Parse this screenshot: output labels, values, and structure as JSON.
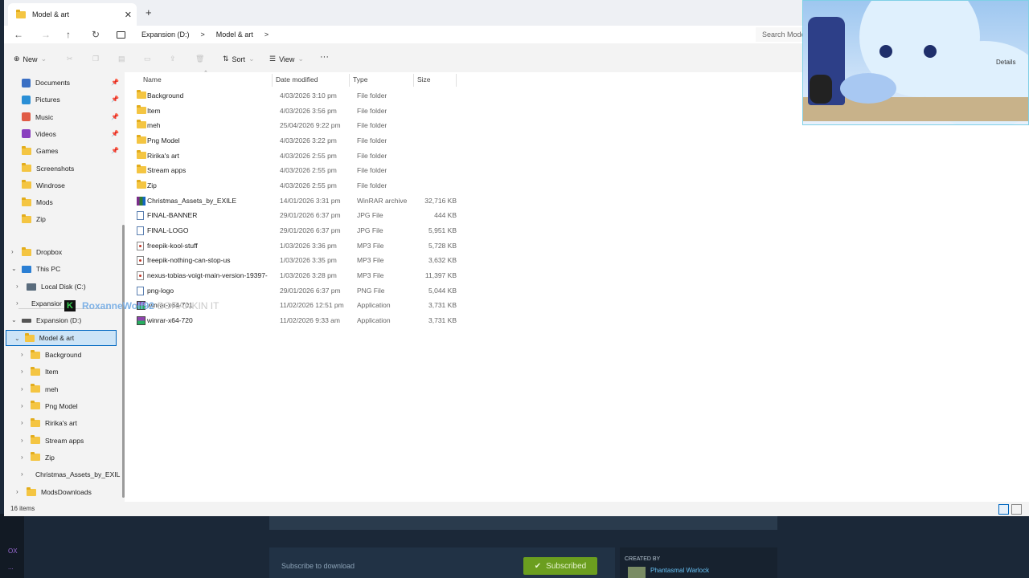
{
  "window": {
    "tab_title": "Model & art",
    "tab_close": "✕",
    "new_tab": "+",
    "controls": [
      "—",
      "▢",
      "✕"
    ]
  },
  "nav": {
    "back": "←",
    "forward": "→",
    "up": "↑",
    "refresh": "↻",
    "breadcrumb": [
      "Expansion (D:)",
      ">",
      "Model & art",
      ">"
    ],
    "search_placeholder": "Search Model & art"
  },
  "toolbar": {
    "new_label": "New",
    "sort_label": "Sort",
    "view_label": "View",
    "more": "···",
    "details_label": "Details"
  },
  "sidebar": {
    "quick": [
      {
        "label": "Documents",
        "icon": "documents-icon",
        "color": "#3a6fc4"
      },
      {
        "label": "Pictures",
        "icon": "pictures-icon",
        "color": "#2a8fd6"
      },
      {
        "label": "Music",
        "icon": "music-icon",
        "color": "#e05b45"
      },
      {
        "label": "Videos",
        "icon": "videos-icon",
        "color": "#8a3fbf"
      },
      {
        "label": "Games",
        "icon": "folder-icon"
      },
      {
        "label": "Screenshots",
        "icon": "folder-icon"
      },
      {
        "label": "Windrose",
        "icon": "folder-icon"
      },
      {
        "label": "Mods",
        "icon": "folder-icon"
      },
      {
        "label": "Zip",
        "icon": "folder-icon"
      }
    ],
    "tree": {
      "dropbox": "Dropbox",
      "this_pc": "This PC",
      "local_disk": "Local Disk (C:)",
      "expansion_collapsed": "Expansion (D:)",
      "expansion": "Expansion (D:)",
      "model_art": "Model & art",
      "children": [
        "Background",
        "Item",
        "meh",
        "Png Model",
        "Ririka's art",
        "Stream apps",
        "Zip",
        "Christmas_Assets_by_EXILE"
      ],
      "mods_downloads": "ModsDownloads"
    }
  },
  "columns": {
    "name": "Name",
    "date": "Date modified",
    "type": "Type",
    "size": "Size"
  },
  "files": [
    {
      "name": "Background",
      "date": "4/03/2026 3:10 pm",
      "type": "File folder",
      "size": "",
      "kind": "folder"
    },
    {
      "name": "Item",
      "date": "4/03/2026 3:56 pm",
      "type": "File folder",
      "size": "",
      "kind": "folder"
    },
    {
      "name": "meh",
      "date": "25/04/2026 9:22 pm",
      "type": "File folder",
      "size": "",
      "kind": "folder"
    },
    {
      "name": "Png Model",
      "date": "4/03/2026 3:22 pm",
      "type": "File folder",
      "size": "",
      "kind": "folder"
    },
    {
      "name": "Ririka's art",
      "date": "4/03/2026 2:55 pm",
      "type": "File folder",
      "size": "",
      "kind": "folder"
    },
    {
      "name": "Stream apps",
      "date": "4/03/2026 2:55 pm",
      "type": "File folder",
      "size": "",
      "kind": "folder"
    },
    {
      "name": "Zip",
      "date": "4/03/2026 2:55 pm",
      "type": "File folder",
      "size": "",
      "kind": "folder"
    },
    {
      "name": "Christmas_Assets_by_EXILE",
      "date": "14/01/2026 3:31 pm",
      "type": "WinRAR archive",
      "size": "32,716 KB",
      "kind": "rar"
    },
    {
      "name": "FINAL-BANNER",
      "date": "29/01/2026 6:37 pm",
      "type": "JPG File",
      "size": "444 KB",
      "kind": "doc"
    },
    {
      "name": "FINAL-LOGO",
      "date": "29/01/2026 6:37 pm",
      "type": "JPG File",
      "size": "5,951 KB",
      "kind": "doc"
    },
    {
      "name": "freepik-kool-stuff",
      "date": "1/03/2026 3:36 pm",
      "type": "MP3 File",
      "size": "5,728 KB",
      "kind": "mp3"
    },
    {
      "name": "freepik-nothing-can-stop-us",
      "date": "1/03/2026 3:35 pm",
      "type": "MP3 File",
      "size": "3,632 KB",
      "kind": "mp3"
    },
    {
      "name": "nexus-tobias-voigt-main-version-19397-...",
      "date": "1/03/2026 3:28 pm",
      "type": "MP3 File",
      "size": "11,397 KB",
      "kind": "mp3"
    },
    {
      "name": "png-logo",
      "date": "29/01/2026 6:37 pm",
      "type": "PNG File",
      "size": "5,044 KB",
      "kind": "doc"
    },
    {
      "name": "winrar-x64-701",
      "date": "11/02/2026 12:51 pm",
      "type": "Application",
      "size": "3,731 KB",
      "kind": "app"
    },
    {
      "name": "winrar-x64-720",
      "date": "11/02/2026 9:33 am",
      "type": "Application",
      "size": "3,731 KB",
      "kind": "app"
    }
  ],
  "status": {
    "count": "16 items"
  },
  "overlay": {
    "k": "K",
    "name": "RoxanneWolf92",
    "tag": "BORANKIN IT"
  },
  "steam": {
    "subscribe_label": "Subscribe to download",
    "subscribed": "Subscribed",
    "check": "✔",
    "created_by": "CREATED BY",
    "creator": "Phantasmal Warlock",
    "strip_top": "OX",
    "strip_bottom": "..."
  }
}
